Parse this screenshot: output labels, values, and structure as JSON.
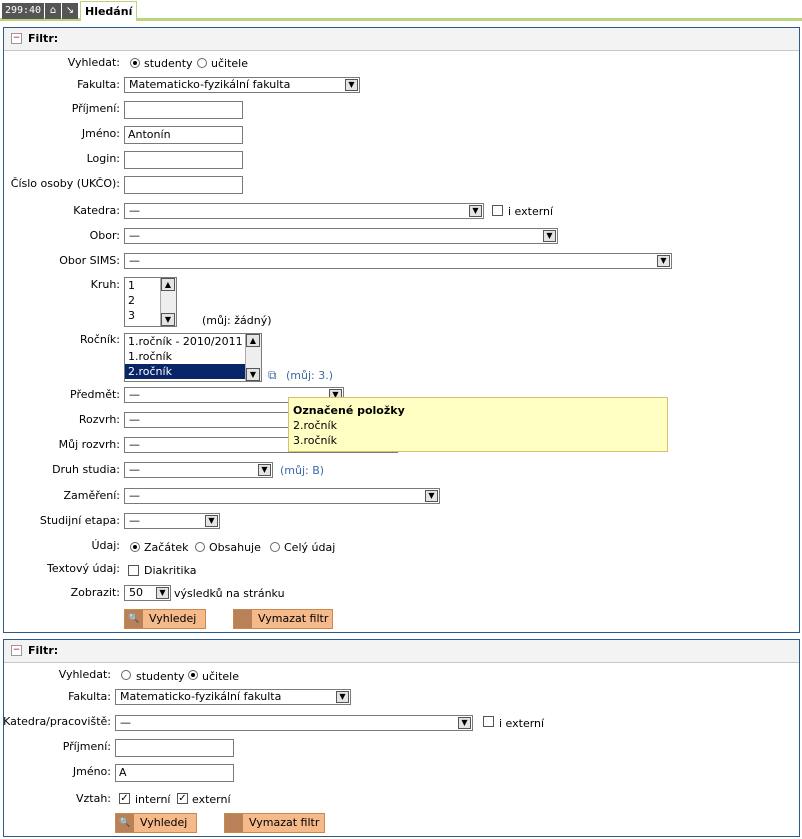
{
  "topbar": {
    "timer": "299:40",
    "tab_label": "Hledání"
  },
  "filter1": {
    "title": "Filtr:",
    "vyhledat_label": "Vyhledat:",
    "opt_students": "studenty",
    "opt_teachers": "učitele",
    "fakulta_label": "Fakulta:",
    "fakulta_value": "Matematicko-fyzikální fakulta",
    "prijmeni_label": "Příjmení:",
    "prijmeni_value": "",
    "jmeno_label": "Jméno:",
    "jmeno_value": "Antonín",
    "login_label": "Login:",
    "login_value": "",
    "cislo_label": "Číslo osoby (UKČO):",
    "cislo_value": "",
    "katedra_label": "Katedra:",
    "katedra_value": "—",
    "i_externi": "i externí",
    "obor_label": "Obor:",
    "obor_value": "—",
    "obor_sims_label": "Obor SIMS:",
    "obor_sims_value": "—",
    "kruh_label": "Kruh:",
    "kruh_items": [
      "1",
      "2",
      "3"
    ],
    "kruh_muj": "(můj: žádný)",
    "rocnik_label": "Ročník:",
    "rocnik_items": [
      "1.ročník - 2010/2011",
      "1.ročník",
      "2.ročník"
    ],
    "rocnik_muj": "(můj: 3.)",
    "predmet_label": "Předmět:",
    "predmet_value": "—",
    "rozvrh_label": "Rozvrh:",
    "rozvrh_value": "—",
    "muj_rozvrh_label": "Můj rozvrh:",
    "muj_rozvrh_value": "—",
    "druh_label": "Druh studia:",
    "druh_value": "—",
    "druh_muj": "(můj: B)",
    "zamereni_label": "Zaměření:",
    "zamereni_value": "—",
    "etapa_label": "Studijní etapa:",
    "etapa_value": "—",
    "udaj_label": "Údaj:",
    "udaj_opt1": "Začátek",
    "udaj_opt2": "Obsahuje",
    "udaj_opt3": "Celý údaj",
    "textovy_label": "Textový údaj:",
    "diakritika": "Diakritika",
    "zobrazit_label": "Zobrazit:",
    "zobrazit_value": "50",
    "zobrazit_suffix": "výsledků na stránku",
    "search_btn": "Vyhledej",
    "clear_btn": "Vymazat filtr"
  },
  "tooltip": {
    "title": "Označené položky",
    "items": [
      "2.ročník",
      "3.ročník"
    ]
  },
  "filter2": {
    "title": "Filtr:",
    "vyhledat_label": "Vyhledat:",
    "opt_students": "studenty",
    "opt_teachers": "učitele",
    "fakulta_label": "Fakulta:",
    "fakulta_value": "Matematicko-fyzikální fakulta",
    "katedra_label": "Katedra/pracoviště:",
    "katedra_value": "—",
    "i_externi": "i externí",
    "prijmeni_label": "Příjmení:",
    "prijmeni_value": "",
    "jmeno_label": "Jméno:",
    "jmeno_value": "A",
    "vztah_label": "Vztah:",
    "interni": "interní",
    "externi": "externí",
    "search_btn": "Vyhledej",
    "clear_btn": "Vymazat filtr"
  }
}
